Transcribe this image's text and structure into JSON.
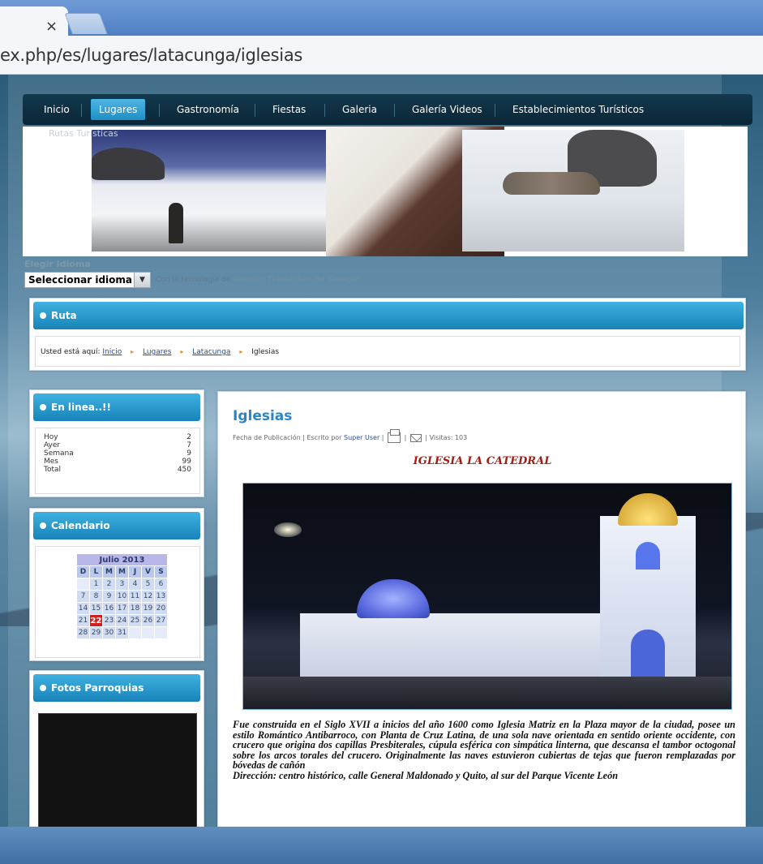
{
  "browser": {
    "tab_close": "×",
    "url": "ex.php/es/lugares/latacunga/iglesias"
  },
  "nav": {
    "items": [
      "Inicio",
      "Lugares",
      "Gastronomía",
      "Fiestas",
      "Galeria",
      "Galería Videos",
      "Establecimientos Turísticos"
    ],
    "active": "Lugares",
    "sub": "Rutas Turísticas"
  },
  "language": {
    "label": "Elegir Idioma",
    "select_value": "Seleccionar idioma",
    "powered_prefix": "Con la tecnología de",
    "powered_google": "Google",
    "powered_suffix": "Traductor de Google"
  },
  "ruta": {
    "title": "Ruta",
    "prefix": "Usted está aquí:",
    "crumbs": [
      "Inicio",
      "Lugares",
      "Latacunga"
    ],
    "current": "Iglesias"
  },
  "online": {
    "title": "En linea..!!",
    "rows": [
      {
        "label": "Hoy",
        "value": "2"
      },
      {
        "label": "Ayer",
        "value": "7"
      },
      {
        "label": "Semana",
        "value": "9"
      },
      {
        "label": "Mes",
        "value": "99"
      },
      {
        "label": "Total",
        "value": "450"
      }
    ]
  },
  "calendar": {
    "title": "Calendario",
    "month": "Julio 2013",
    "weekdays": [
      "D",
      "L",
      "M",
      "M",
      "J",
      "V",
      "S"
    ],
    "weeks": [
      [
        "",
        "1",
        "2",
        "3",
        "4",
        "5",
        "6"
      ],
      [
        "7",
        "8",
        "9",
        "10",
        "11",
        "12",
        "13"
      ],
      [
        "14",
        "15",
        "16",
        "17",
        "18",
        "19",
        "20"
      ],
      [
        "21",
        "22",
        "23",
        "24",
        "25",
        "26",
        "27"
      ],
      [
        "28",
        "29",
        "30",
        "31",
        "",
        "",
        ""
      ]
    ],
    "today": "22"
  },
  "fotos": {
    "title": "Fotos Parroquias"
  },
  "article": {
    "title": "Iglesias",
    "meta_prefix": "Fecha de Publicación | Escrito por",
    "author": "Super User",
    "meta_suffix": "| Visitas: 103",
    "heading": "IGLESIA LA CATEDRAL",
    "body": "Fue construida en el Siglo XVII a inicios del año 1600 como Iglesia Matriz en la Plaza mayor de la ciudad, posee un estilo Romántico Antibarroco, con Planta de Cruz Latina, de una sola nave orientada en sentido oriente occidente, con crucero que origina dos capillas Presbiterales, cúpula esférica con simpática linterna, que descansa el tambor octogonal sobre los arcos torales del crucero. Originalmente las naves estuvieron cubiertas de tejas que fueron remplazadas por bóvedas de cañón",
    "address": "Dirección: centro histórico, calle General Maldonado y Quito, al sur del Parque Vicente León"
  }
}
